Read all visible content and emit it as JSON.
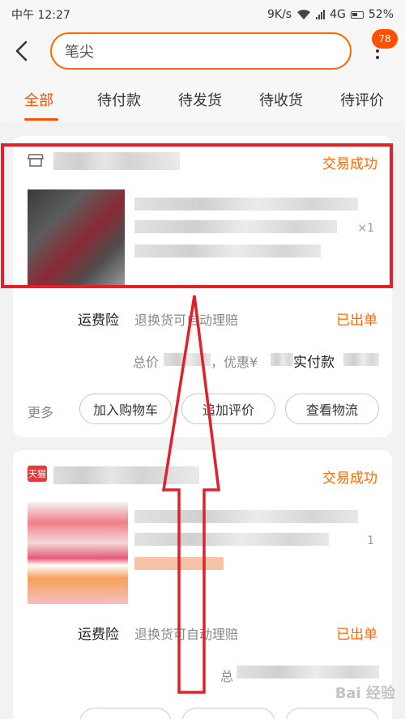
{
  "status_bar": {
    "time": "中午 12:27",
    "speed": "9K/s",
    "network": "4G",
    "battery": "52%"
  },
  "header": {
    "search_value": "笔尖",
    "badge_count": "78"
  },
  "tabs": [
    "全部",
    "待付款",
    "待发货",
    "待收货",
    "待评价"
  ],
  "orders": [
    {
      "status": "交易成功",
      "qty": "×1",
      "service_label": "运费险",
      "service_text": "退换货可自动理赔",
      "out_status": "已出单",
      "total_prefix": "总价",
      "discount_label": "，优惠¥",
      "paid_label": "实付款",
      "more": "更多",
      "buttons": [
        "加入购物车",
        "追加评价",
        "查看物流"
      ]
    },
    {
      "store_badge": "天猫",
      "status": "交易成功",
      "qty": "1",
      "service_label": "运费险",
      "service_text": "退换货可自动理赔",
      "out_status": "已出单",
      "total_prefix": "总"
    }
  ],
  "watermark": "Bai 经验",
  "colors": {
    "accent": "#ff5000",
    "highlight": "#e0202a"
  }
}
